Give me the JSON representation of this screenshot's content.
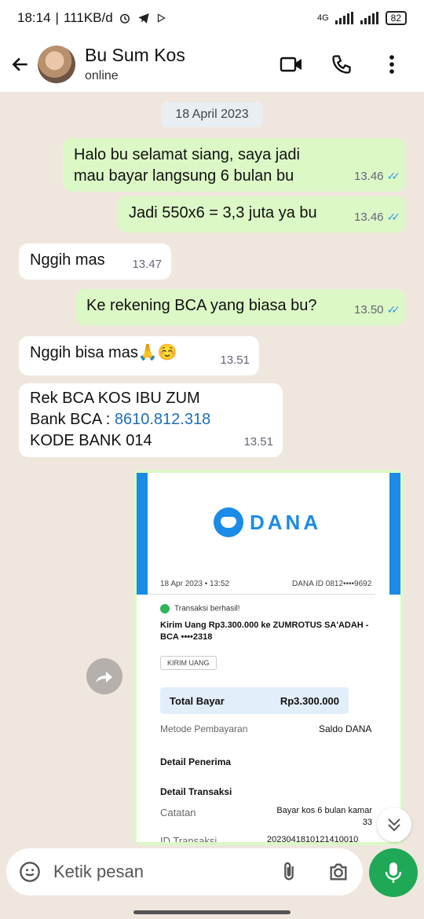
{
  "status_bar": {
    "time": "18:14",
    "speed": "111KB/d",
    "network": "4G",
    "battery": "82"
  },
  "header": {
    "contact_name": "Bu Sum Kos",
    "contact_status": "online",
    "icons": [
      "back-arrow-icon",
      "video-call-icon",
      "voice-call-icon",
      "more-vert-icon"
    ]
  },
  "chat": {
    "date_chip": "18 April 2023",
    "messages": [
      {
        "dir": "out",
        "text": "Halo bu selamat siang, saya jadi mau bayar langsung 6 bulan bu",
        "time": "13.46",
        "read": true
      },
      {
        "dir": "out",
        "text": "Jadi 550x6 = 3,3 juta ya bu",
        "time": "13.46",
        "read": true
      },
      {
        "dir": "in",
        "text": "Nggih mas",
        "time": "13.47"
      },
      {
        "dir": "out",
        "text": "Ke rekening BCA yang biasa bu?",
        "time": "13.50",
        "read": true
      },
      {
        "dir": "in",
        "text": "Nggih bisa mas🙏☺️",
        "time": "13.51"
      },
      {
        "dir": "in",
        "line1": "Rek BCA KOS IBU ZUM",
        "line2_prefix": "Bank BCA : ",
        "line2_link": "8610.812.318",
        "line3": "KODE BANK 014",
        "time": "13.51"
      }
    ]
  },
  "receipt": {
    "brand": "DANA",
    "date": "18 Apr 2023 • 13:52",
    "dana_id": "DANA ID 0812••••9692",
    "status": "Transaksi berhasil!",
    "description": "Kirim Uang Rp3.300.000 ke ZUMROTUS SA'ADAH - BCA ••••2318",
    "chip": "KIRIM UANG",
    "total_label": "Total Bayar",
    "total_value": "Rp3.300.000",
    "method_label": "Metode Pembayaran",
    "method_value": "Saldo DANA",
    "recipient_label": "Detail Penerima",
    "transaction_label": "Detail Transaksi",
    "note_label": "Catatan",
    "note_value": "Bayar kos 6 bulan kamar 33",
    "id_label": "ID Transaksi",
    "id_value": "2023041810121410010"
  },
  "composer": {
    "placeholder": "Ketik pesan"
  }
}
